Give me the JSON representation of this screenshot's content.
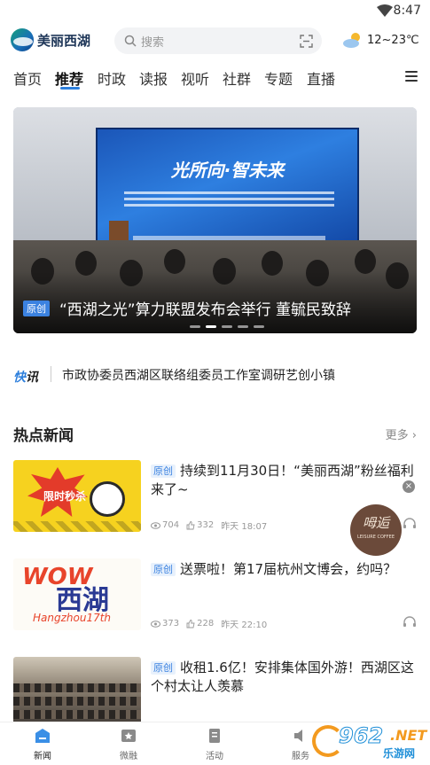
{
  "status_bar": {
    "time": "8:47"
  },
  "header": {
    "app_name": "美丽西湖",
    "search_placeholder": "搜索",
    "weather": "12~23℃"
  },
  "nav": {
    "tabs": [
      "首页",
      "推荐",
      "时政",
      "读报",
      "视听",
      "社群",
      "专题",
      "直播"
    ],
    "active": "推荐"
  },
  "banner": {
    "badge": "原创",
    "caption": "“西湖之光”算力联盟发布会举行 董毓民致辞",
    "screen_title": "光所向·智未来",
    "slides": 5,
    "active_slide": 1
  },
  "flash": {
    "label_a": "快",
    "label_b": "讯",
    "text": "市政协委员西湖区联络组委员工作室调研艺创小镇"
  },
  "hot_news": {
    "title": "热点新闻",
    "more": "更多 ›",
    "items": [
      {
        "tag": "原创",
        "title": "持续到11月30日！“美丽西湖”粉丝福利来了~",
        "views": "704",
        "likes": "332",
        "time": "昨天 18:07",
        "thumb_text": "限时秒杀"
      },
      {
        "tag": "原创",
        "title": "送票啦！第17届杭州文博会，约吗？",
        "views": "373",
        "likes": "228",
        "time": "昨天 22:10",
        "thumb_text_a": "WOW",
        "thumb_text_b": "西湖",
        "thumb_text_c": "Hangzhou17th"
      },
      {
        "tag": "原创",
        "title": "收租1.6亿！安排集体国外游！西湖区这个村太让人羡慕",
        "views": "",
        "likes": "",
        "time": ""
      }
    ]
  },
  "float_ad": {
    "text": "呣逅",
    "sub": "LEISURE COFFEE"
  },
  "tab_bar": {
    "tabs": [
      {
        "label": "新闻",
        "active": true
      },
      {
        "label": "微融",
        "active": false
      },
      {
        "label": "活动",
        "active": false
      },
      {
        "label": "服务",
        "active": false
      }
    ]
  },
  "watermark": {
    "num": "962",
    "net": ".NET",
    "cn": "乐游网"
  },
  "colors": {
    "accent": "#2d7fdc",
    "tag_bg": "#e8f1fc"
  }
}
